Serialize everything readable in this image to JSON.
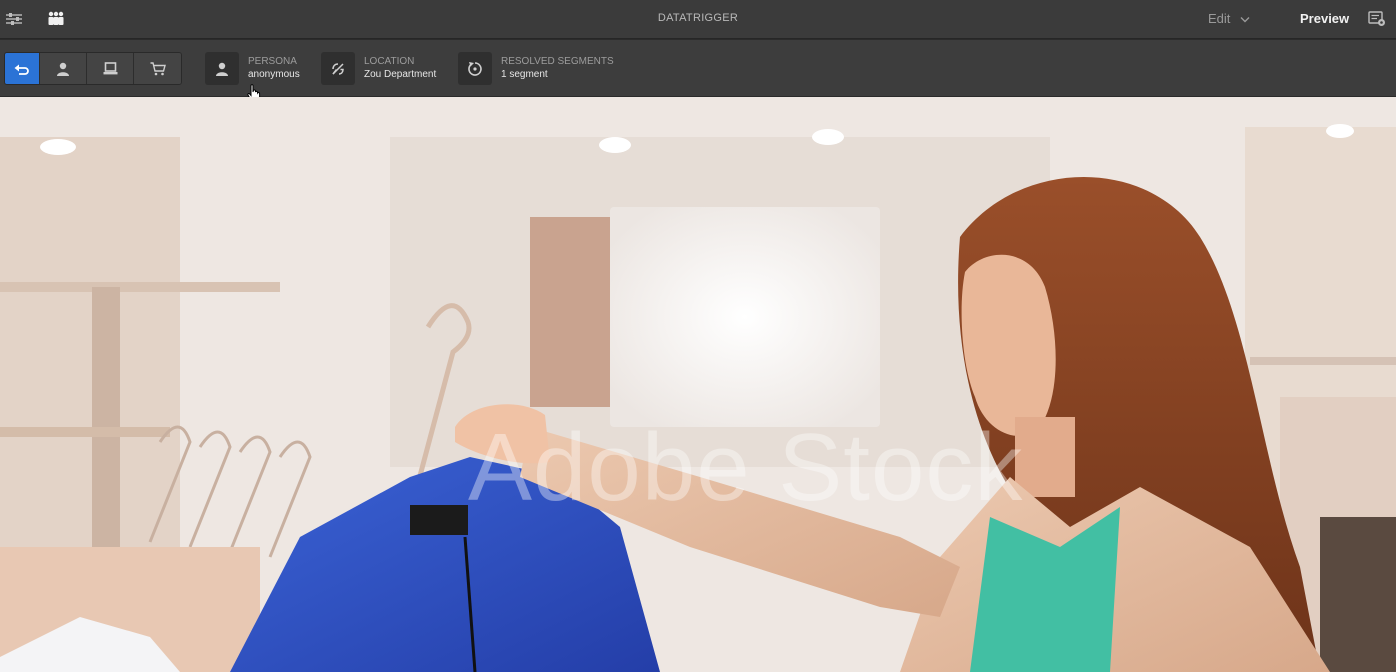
{
  "app": {
    "title": "DATATRIGGER"
  },
  "topbar": {
    "left_icons": [
      "sliders-icon",
      "people-icon"
    ],
    "mode_dropdown": {
      "value": "Edit"
    },
    "preview_label": "Preview",
    "right_icon": "page-info-icon"
  },
  "toolbar": {
    "view_buttons": [
      {
        "icon": "undo-icon",
        "active": true
      },
      {
        "icon": "person-icon",
        "active": false
      },
      {
        "icon": "device-icon",
        "active": false
      },
      {
        "icon": "cart-icon",
        "active": false
      }
    ],
    "context": {
      "persona": {
        "label": "PERSONA",
        "value": "anonymous"
      },
      "location": {
        "label": "LOCATION",
        "value": "Zou Department"
      },
      "segments": {
        "label": "RESOLVED SEGMENTS",
        "value": "1 segment"
      }
    }
  },
  "hero": {
    "watermark": "Adobe Stock"
  },
  "colors": {
    "topbar": "#3b3b3b",
    "toolbar": "#3d3d3d",
    "accent": "#2b73d6"
  }
}
